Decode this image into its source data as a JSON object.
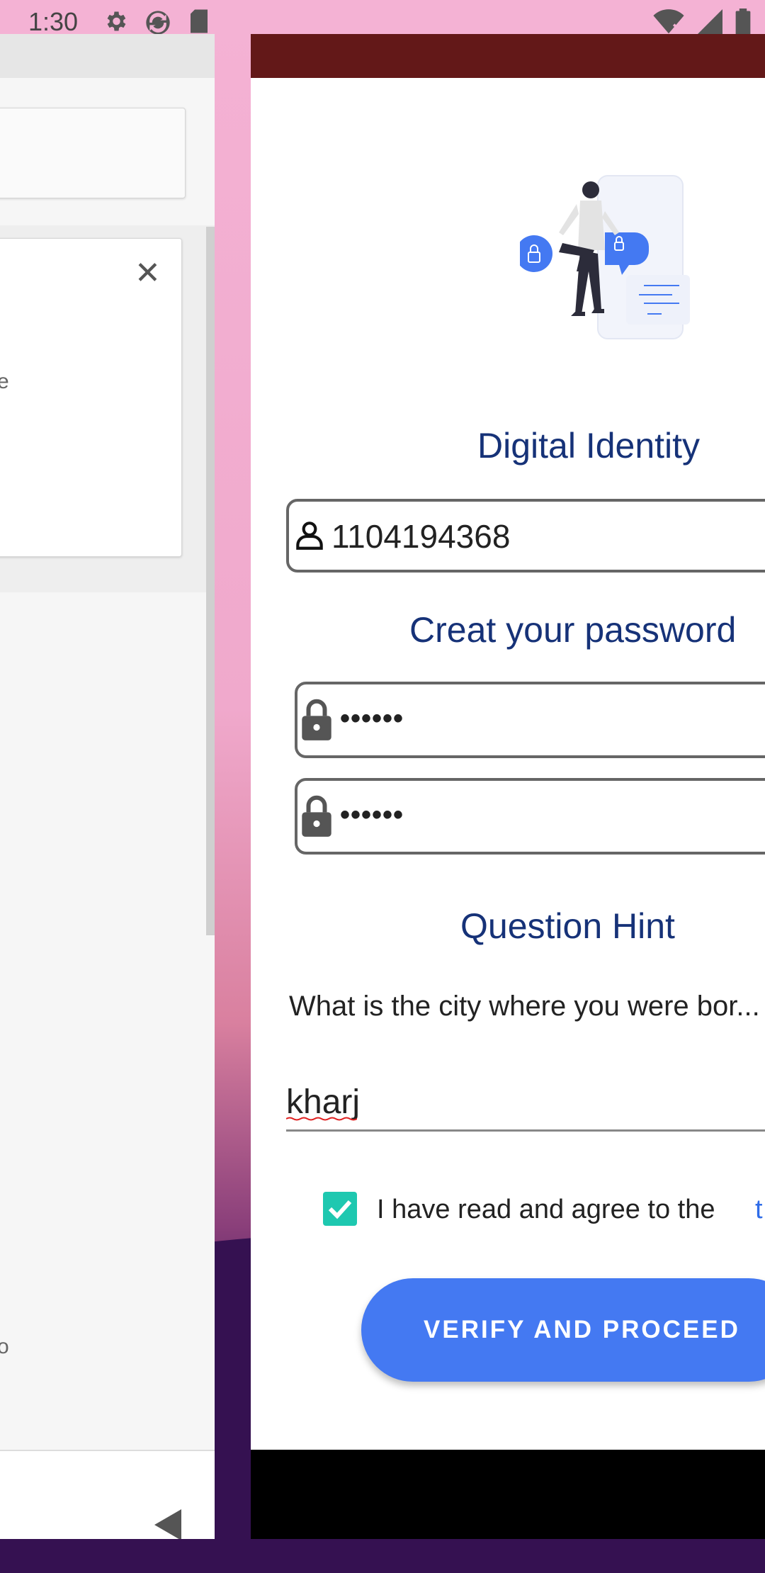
{
  "status_bar": {
    "time": "1:30",
    "icons_left": [
      "gear-icon",
      "sync-icon",
      "sd-card-icon"
    ],
    "icons_right": [
      "wifi-off-icon",
      "signal-icon",
      "battery-icon"
    ]
  },
  "left_app": {
    "partial_text_e": "e",
    "partial_text_o": "o",
    "close_icon": "close-icon"
  },
  "right_app": {
    "illustration": "security-illustration",
    "digital_identity_title": "Digital Identity",
    "id_number": "1104194368",
    "create_password_title": "Creat  your password",
    "password_masked": "••••••",
    "confirm_password_masked": "••••••",
    "question_hint_title": "Question Hint",
    "question_text": "What is the city where you were bor...",
    "answer_value": "kharj",
    "agree_text": "I have read and agree to the",
    "terms_link_partial": "t",
    "agree_checked": true,
    "verify_button": "VERIFY AND PROCEED"
  },
  "colors": {
    "heading": "#163278",
    "button": "#4479f2",
    "checkbox": "#1ec8b0",
    "topbar": "#631818"
  }
}
